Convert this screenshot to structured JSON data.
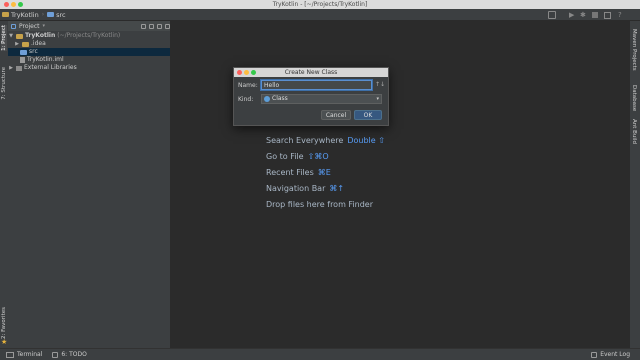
{
  "window": {
    "title": "TryKotlin - [~/Projects/TryKotlin]"
  },
  "navbar": {
    "project": "TryKotlin",
    "folder": "src"
  },
  "left_tool_windows": {
    "project": "1: Project",
    "structure": "7: Structure",
    "favorites": "2: Favorites"
  },
  "right_tool_windows": {
    "maven": "Maven Projects",
    "database": "Database",
    "ant": "Ant Build"
  },
  "project_panel": {
    "view_selector": "Project",
    "tree": {
      "root_name": "TryKotlin",
      "root_path": "(~/Projects/TryKotlin)",
      "idea": ".idea",
      "src": "src",
      "iml": "TryKotlin.iml",
      "external": "External Libraries"
    }
  },
  "editor_hints": {
    "search_everywhere": {
      "label": "Search Everywhere",
      "shortcut": "Double ⇧"
    },
    "goto_file": {
      "label": "Go to File",
      "shortcut": "⇧⌘O"
    },
    "recent_files": {
      "label": "Recent Files",
      "shortcut": "⌘E"
    },
    "navigation_bar": {
      "label": "Navigation Bar",
      "shortcut": "⌘↑"
    },
    "drop_files": {
      "label": "Drop files here from Finder"
    }
  },
  "dialog": {
    "title": "Create New Class",
    "name_label": "Name:",
    "name_value": "Hello",
    "kind_label": "Kind:",
    "kind_value": "Class",
    "cancel": "Cancel",
    "ok": "OK"
  },
  "statusbar": {
    "terminal": "Terminal",
    "todo": "6: TODO",
    "event_log": "Event Log"
  },
  "colors": {
    "accent_blue": "#589df6",
    "ok_button": "#365880",
    "selection": "#0d293e"
  }
}
